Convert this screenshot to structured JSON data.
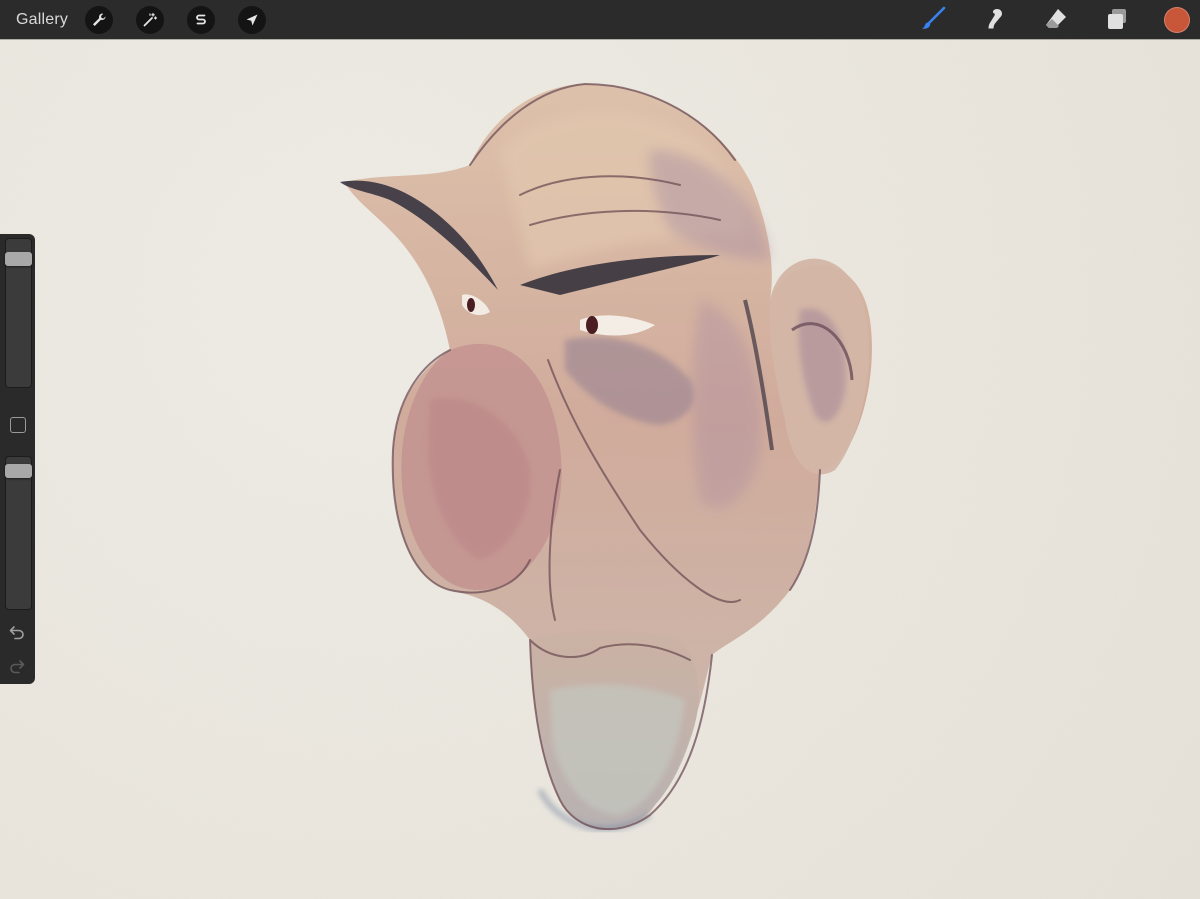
{
  "topbar": {
    "gallery_label": "Gallery",
    "left_tools": [
      "wrench-icon",
      "magic-wand-icon",
      "selection-s-icon",
      "transform-arrow-icon"
    ],
    "right_tools": [
      "brush-icon",
      "smudge-icon",
      "eraser-icon",
      "layers-icon"
    ],
    "active_tool": "brush",
    "current_color": "#c8573a"
  },
  "sidebar": {
    "brush_size_fraction": 0.1,
    "opacity_fraction": 0.95,
    "icons": [
      "modify-square-icon",
      "undo-icon",
      "redo-icon"
    ]
  },
  "canvas": {
    "paper_color": "#ece8e0",
    "artwork": "watercolor-caricature-head"
  }
}
